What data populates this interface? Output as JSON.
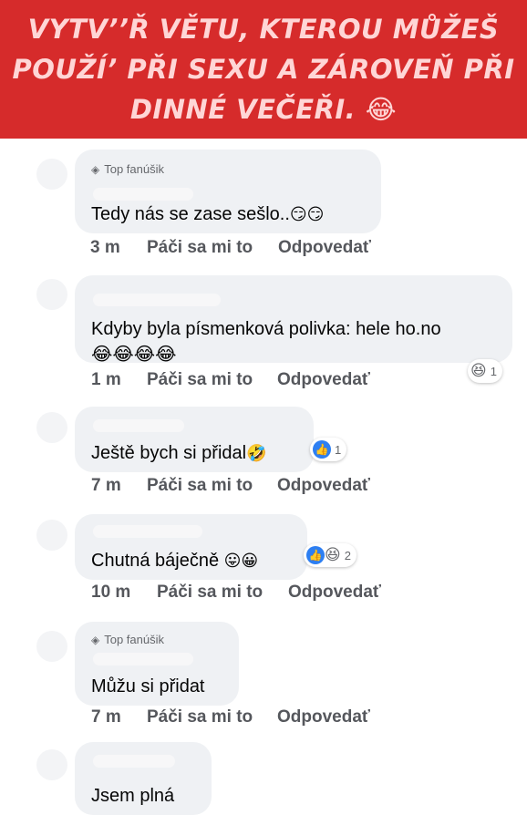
{
  "banner": {
    "lines": [
      "VYTV’’Ř VĚTU, KTEROU MŮŽEŠ",
      "POUŽÍ’ PŘI SEXU A ZÁROVEŇ PŘI",
      "DINNÉ VEČEŘI."
    ],
    "emoji": "😂"
  },
  "comments": [
    {
      "badge": "Top fanúšik",
      "badge_icon": "diamond-icon",
      "text": "Tedy nás se zase sešlo..",
      "emoji": "😏😏",
      "time": "3 m",
      "like": "Páči sa mi to",
      "reply": "Odpovedať"
    },
    {
      "text": "Kdyby byla písmenková polivka: hele ho.no",
      "emoji_line": "😂😂😂😂",
      "time": "1 m",
      "like": "Páči sa mi to",
      "reply": "Odpovedať",
      "reaction_emoji": "😆",
      "reaction_count": "1"
    },
    {
      "text": "Ještě bych si přidal",
      "emoji": "🤣",
      "time": "7 m",
      "like": "Páči sa mi to",
      "reply": "Odpovedať",
      "reaction_like": "👍",
      "reaction_count": "1"
    },
    {
      "text": "Chutná báječně",
      "emoji": "😛😀",
      "time": "10 m",
      "like": "Páči sa mi to",
      "reply": "Odpovedať",
      "reaction_like": "👍",
      "reaction_emoji": "😆",
      "reaction_count": "2"
    },
    {
      "badge": "Top fanúšik",
      "badge_icon": "diamond-icon",
      "text": "Můžu si přidat",
      "time": "7 m",
      "like": "Páči sa mi to",
      "reply": "Odpovedať"
    },
    {
      "text": "Jsem plná"
    }
  ],
  "colors": {
    "banner_bg": "#d62b2b",
    "banner_text": "#ffd6d6",
    "bubble_bg": "#eff1f4",
    "meta_text": "#55575c",
    "like_blue": "#2d7ff2"
  }
}
